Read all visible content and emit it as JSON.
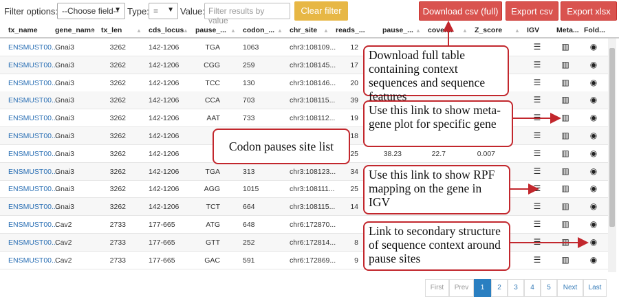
{
  "toolbar": {
    "filter_options_label": "Filter options:",
    "field_select": "--Choose field--",
    "type_label": "Type:",
    "type_select": "=",
    "value_label": "Value:",
    "value_placeholder": "Filter results by value",
    "clear_filter": "Clear filter",
    "download_csv_full": "Download csv (full)",
    "export_csv": "Export csv",
    "export_xlsx": "Export xlsx"
  },
  "table": {
    "headers": [
      "tx_name",
      "gene_name",
      "tx_len",
      "cds_locus",
      "pause_...",
      "codon_...",
      "chr_site",
      "reads_...",
      "pause_...",
      "cover...",
      "Z_score",
      "IGV",
      "Meta...",
      "Fold..."
    ],
    "rows": [
      [
        "ENSMUST00...",
        "Gnai3",
        "3262",
        "142-1206",
        "TGA",
        "1063",
        "chr3:108109...",
        "12",
        "",
        "",
        ""
      ],
      [
        "ENSMUST00...",
        "Gnai3",
        "3262",
        "142-1206",
        "CGG",
        "259",
        "chr3:108145...",
        "17",
        "",
        "",
        ""
      ],
      [
        "ENSMUST00...",
        "Gnai3",
        "3262",
        "142-1206",
        "TCC",
        "130",
        "chr3:108146...",
        "20",
        "",
        "",
        ""
      ],
      [
        "ENSMUST00...",
        "Gnai3",
        "3262",
        "142-1206",
        "CCA",
        "703",
        "chr3:108115...",
        "39",
        "",
        "",
        ""
      ],
      [
        "ENSMUST00...",
        "Gnai3",
        "3262",
        "142-1206",
        "AAT",
        "733",
        "chr3:108112...",
        "19",
        "",
        "",
        ""
      ],
      [
        "ENSMUST00...",
        "Gnai3",
        "3262",
        "142-1206",
        "",
        "",
        "",
        "18",
        "",
        "",
        ""
      ],
      [
        "ENSMUST00...",
        "Gnai3",
        "3262",
        "142-1206",
        "",
        "",
        "",
        "25",
        "38.23",
        "22.7",
        "0.007"
      ],
      [
        "ENSMUST00...",
        "Gnai3",
        "3262",
        "142-1206",
        "TGA",
        "313",
        "chr3:108123...",
        "34",
        "",
        "",
        ""
      ],
      [
        "ENSMUST00...",
        "Gnai3",
        "3262",
        "142-1206",
        "AGG",
        "1015",
        "chr3:108111...",
        "25",
        "",
        "",
        ""
      ],
      [
        "ENSMUST00...",
        "Gnai3",
        "3262",
        "142-1206",
        "TCT",
        "664",
        "chr3:108115...",
        "14",
        "",
        "",
        ""
      ],
      [
        "ENSMUST00...",
        "Cav2",
        "2733",
        "177-665",
        "ATG",
        "648",
        "chr6:172870...",
        "",
        "",
        "",
        ""
      ],
      [
        "ENSMUST00...",
        "Cav2",
        "2733",
        "177-665",
        "GTT",
        "252",
        "chr6:172814...",
        "8",
        "",
        "",
        ""
      ],
      [
        "ENSMUST00...",
        "Cav2",
        "2733",
        "177-665",
        "GAC",
        "591",
        "chr6:172869...",
        "9",
        "",
        "",
        ""
      ]
    ],
    "icons": {
      "igv": "list-icon",
      "meta": "bar-chart-icon",
      "fold": "target-icon"
    }
  },
  "pagination": {
    "first": "First",
    "prev": "Prev",
    "pages": [
      "1",
      "2",
      "3",
      "4",
      "5"
    ],
    "next": "Next",
    "last": "Last",
    "active": "1"
  },
  "annotations": {
    "download": "Download full table containing context sequences and sequence features",
    "meta": "Use this link to show meta-gene plot for specific gene",
    "igv": "Use this link to show RPF mapping on the gene in IGV",
    "fold": "Link to secondary structure of sequence context around pause sites",
    "list": "Codon pauses site list"
  },
  "colors": {
    "accent_red": "#d9534f",
    "accent_yellow": "#e7b745",
    "link_blue": "#2a6fb4",
    "callout_border": "#c2272d"
  }
}
